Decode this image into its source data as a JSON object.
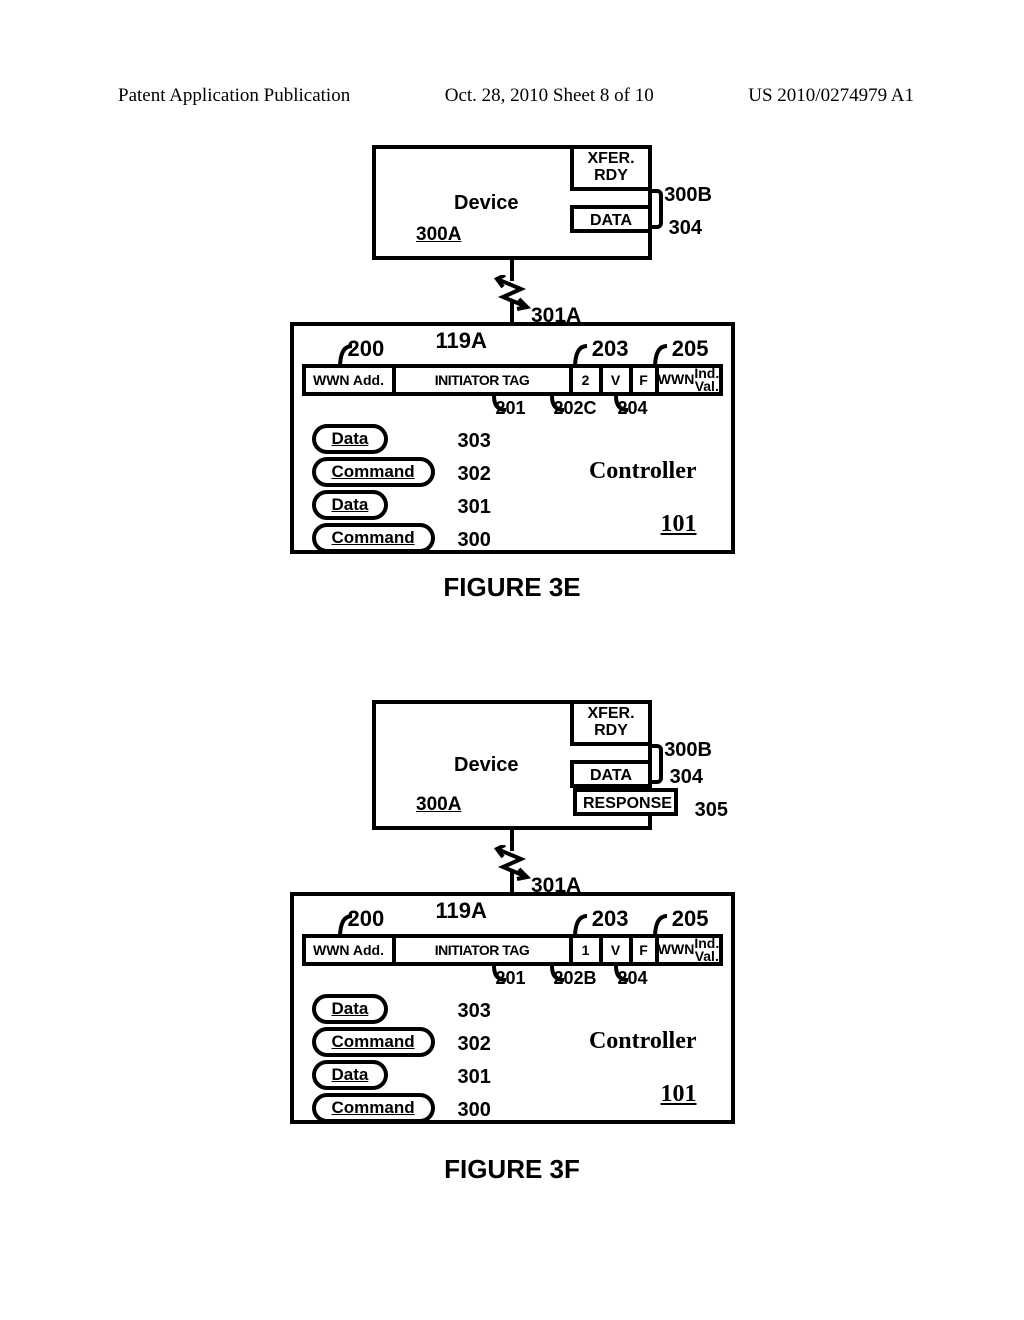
{
  "header": {
    "left": "Patent Application Publication",
    "center": "Oct. 28, 2010  Sheet 8 of 10",
    "right": "US 2010/0274979 A1"
  },
  "figE": {
    "device": {
      "label": "Device",
      "ref": "300A",
      "xfer": "XFER.",
      "rdy": "RDY",
      "data": "DATA",
      "tag_300b": "300B",
      "tag_304": "304"
    },
    "link": {
      "ref": "301A"
    },
    "controller": {
      "label": "Controller",
      "ref": "101",
      "tag119a": "119A",
      "r200": "200",
      "r203": "203",
      "r205": "205",
      "c_wwn": "WWN Add.",
      "c_init": "INITIATOR TAG",
      "c_num": "2",
      "c_v": "V",
      "c_f": "F",
      "c_ind_line1": "WWN",
      "c_ind_line2": "Ind. Val.",
      "r201": "201",
      "r202": "202C",
      "r204": "204",
      "pills": [
        {
          "text": "Data",
          "num": "303"
        },
        {
          "text": "Command",
          "num": "302"
        },
        {
          "text": "Data",
          "num": "301"
        },
        {
          "text": "Command",
          "num": "300"
        }
      ]
    },
    "caption": "FIGURE 3E"
  },
  "figF": {
    "device": {
      "label": "Device",
      "ref": "300A",
      "xfer": "XFER.",
      "rdy": "RDY",
      "data": "DATA",
      "resp": "RESPONSE",
      "tag_300b": "300B",
      "tag_304": "304",
      "tag_305": "305"
    },
    "link": {
      "ref": "301A"
    },
    "controller": {
      "label": "Controller",
      "ref": "101",
      "tag119a": "119A",
      "r200": "200",
      "r203": "203",
      "r205": "205",
      "c_wwn": "WWN Add.",
      "c_init": "INITIATOR TAG",
      "c_num": "1",
      "c_v": "V",
      "c_f": "F",
      "c_ind_line1": "WWN",
      "c_ind_line2": "Ind. Val.",
      "r201": "201",
      "r202": "202B",
      "r204": "204",
      "pills": [
        {
          "text": "Data",
          "num": "303"
        },
        {
          "text": "Command",
          "num": "302"
        },
        {
          "text": "Data",
          "num": "301"
        },
        {
          "text": "Command",
          "num": "300"
        }
      ]
    },
    "caption": "FIGURE 3F"
  }
}
